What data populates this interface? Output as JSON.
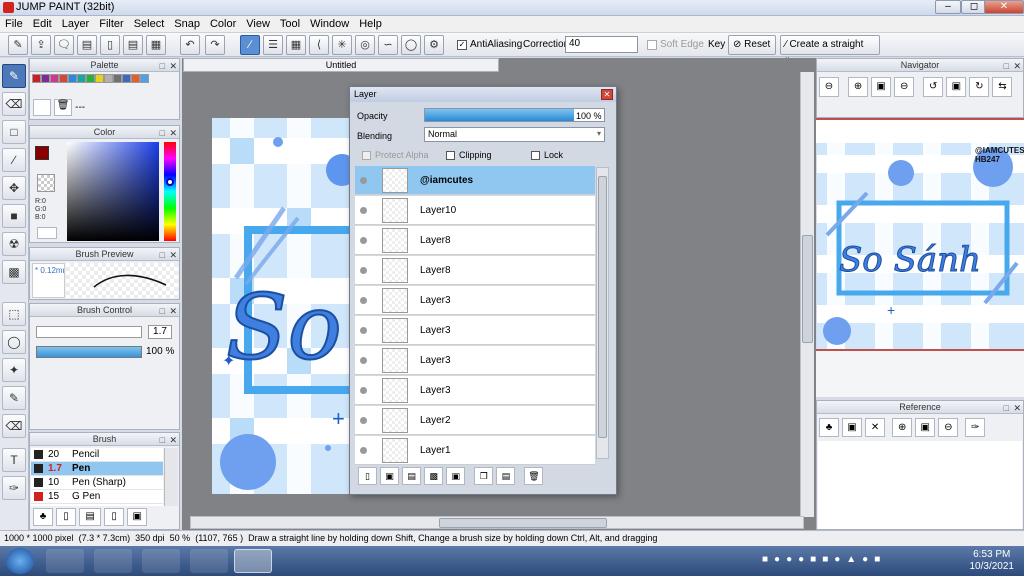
{
  "app": {
    "title": "JUMP PAINT (32bit)"
  },
  "menu": [
    "File",
    "Edit",
    "Layer",
    "Filter",
    "Select",
    "Snap",
    "Color",
    "View",
    "Tool",
    "Window",
    "Help"
  ],
  "toolbar": {
    "antialiasing_label": "AntiAliasing",
    "correction_label": "Correction",
    "correction_value": "40",
    "soft_edge_label": "Soft Edge",
    "key_label": "Key",
    "reset_label": "Reset",
    "straight_line_label": "Create a straight line"
  },
  "panels": {
    "palette_title": "Palette",
    "palette_swatches": [
      "#c8202a",
      "#7a2a9a",
      "#cc3a8f",
      "#d04a3a",
      "#2a8ae0",
      "#17a6a0",
      "#2ab03a",
      "#e8d020",
      "#b0b0b0",
      "#707070",
      "#3a6ac0",
      "#e06030",
      "#50a0e8"
    ],
    "palette_placeholder": "---",
    "color_title": "Color",
    "color_r": "R:0",
    "color_g": "G:0",
    "color_b": "B:0",
    "brush_preview_title": "Brush Preview",
    "brush_preview_size": "0.12mm",
    "brush_control_title": "Brush Control",
    "brush_size_value": "1.7",
    "brush_opacity_value": "100 %",
    "brush_title": "Brush",
    "brush_list": [
      {
        "size": "20",
        "name": "Pencil",
        "color": "#222"
      },
      {
        "size": "1.7",
        "name": "Pen",
        "color": "#222",
        "selected": true
      },
      {
        "size": "10",
        "name": "Pen (Sharp)",
        "color": "#222"
      },
      {
        "size": "15",
        "name": "G Pen",
        "color": "#d02020"
      }
    ],
    "navigator_title": "Navigator",
    "reference_title": "Reference"
  },
  "document": {
    "tab_title": "Untitled",
    "canvas_text": "So",
    "navigator_text": "So  Sánh",
    "watermark_line1": "@IAMCUTES",
    "watermark_line2": "HB247"
  },
  "layer_window": {
    "title": "Layer",
    "opacity_label": "Opacity",
    "opacity_value": "100 %",
    "opacity_fraction": 1.0,
    "blending_label": "Blending",
    "blending_value": "Normal",
    "protect_alpha_label": "Protect Alpha",
    "clipping_label": "Clipping",
    "lock_label": "Lock",
    "layers": [
      {
        "name": "@iamcutes",
        "selected": true
      },
      {
        "name": "Layer10"
      },
      {
        "name": "Layer8"
      },
      {
        "name": "Layer8"
      },
      {
        "name": "Layer3"
      },
      {
        "name": "Layer3"
      },
      {
        "name": "Layer3"
      },
      {
        "name": "Layer3"
      },
      {
        "name": "Layer2"
      },
      {
        "name": "Layer1"
      }
    ]
  },
  "status": {
    "size": "1000 * 1000 pixel",
    "cm": "(7.3 * 7.3cm)",
    "dpi": "350 dpi",
    "zoom": "50 %",
    "coords": "(1107, 765 )",
    "hint": "Draw a straight line by holding down Shift, Change a brush size by holding down Ctrl, Alt, and dragging"
  },
  "taskbar": {
    "time": "6:53 PM",
    "date": "10/3/2021"
  },
  "colors": {
    "accent": "#5b8fd4",
    "canvas_bg": "#cfe6fb",
    "canvas_blue": "#3b82e8",
    "layer_selected": "#8fc7f0"
  }
}
